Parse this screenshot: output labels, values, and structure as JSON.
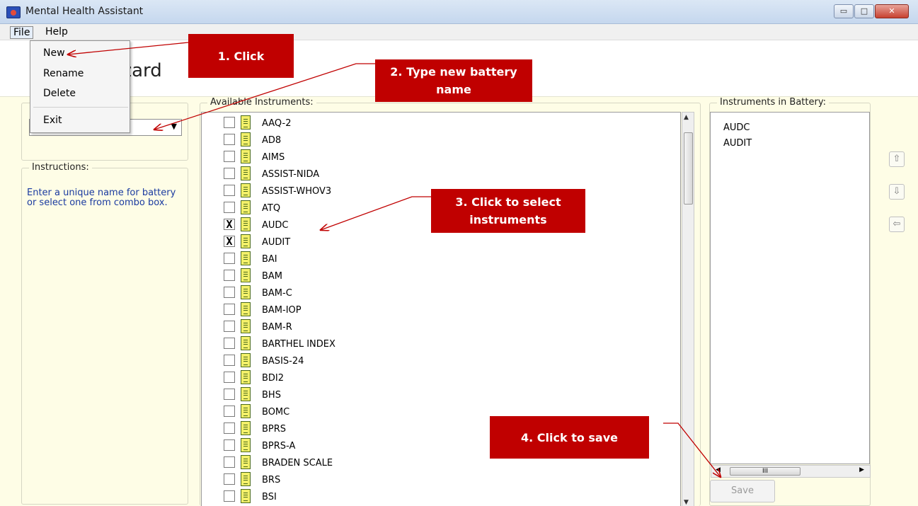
{
  "window": {
    "title": "Mental Health Assistant",
    "min": "▭",
    "max": "□",
    "close": "✕"
  },
  "menubar": {
    "file": "File",
    "help": "Help"
  },
  "file_menu": {
    "new": "New",
    "rename": "Rename",
    "delete": "Delete",
    "exit": "Exit"
  },
  "wizard": {
    "title_partial": "Vizard"
  },
  "instructions": {
    "legend": "Instructions:",
    "text": "Enter a unique name for battery or select one from combo box."
  },
  "available": {
    "legend": "Available Instruments:",
    "items": [
      {
        "name": "AAQ-2",
        "checked": ""
      },
      {
        "name": "AD8",
        "checked": ""
      },
      {
        "name": "AIMS",
        "checked": ""
      },
      {
        "name": "ASSIST-NIDA",
        "checked": ""
      },
      {
        "name": "ASSIST-WHOV3",
        "checked": ""
      },
      {
        "name": "ATQ",
        "checked": ""
      },
      {
        "name": "AUDC",
        "checked": "X"
      },
      {
        "name": "AUDIT",
        "checked": "X"
      },
      {
        "name": "BAI",
        "checked": ""
      },
      {
        "name": "BAM",
        "checked": ""
      },
      {
        "name": "BAM-C",
        "checked": ""
      },
      {
        "name": "BAM-IOP",
        "checked": ""
      },
      {
        "name": "BAM-R",
        "checked": ""
      },
      {
        "name": "BARTHEL INDEX",
        "checked": ""
      },
      {
        "name": "BASIS-24",
        "checked": ""
      },
      {
        "name": "BDI2",
        "checked": ""
      },
      {
        "name": "BHS",
        "checked": ""
      },
      {
        "name": "BOMC",
        "checked": ""
      },
      {
        "name": "BPRS",
        "checked": ""
      },
      {
        "name": "BPRS-A",
        "checked": ""
      },
      {
        "name": "BRADEN SCALE",
        "checked": ""
      },
      {
        "name": "BRS",
        "checked": ""
      },
      {
        "name": "BSI",
        "checked": ""
      }
    ]
  },
  "battery": {
    "legend": "Instruments in Battery:",
    "items": [
      "AUDC",
      "AUDIT"
    ],
    "save_label": "Save"
  },
  "side_buttons": {
    "up": "⇧",
    "down": "⇩",
    "remove": "⇦"
  },
  "callouts": {
    "step1": "1. Click",
    "step2": "2. Type new battery name",
    "step3": "3. Click to select instruments",
    "step4": "4. Click to save"
  },
  "colors": {
    "callout": "#c00000",
    "panel_bg": "#fefde6",
    "instructions_text": "#1a3aa0"
  }
}
